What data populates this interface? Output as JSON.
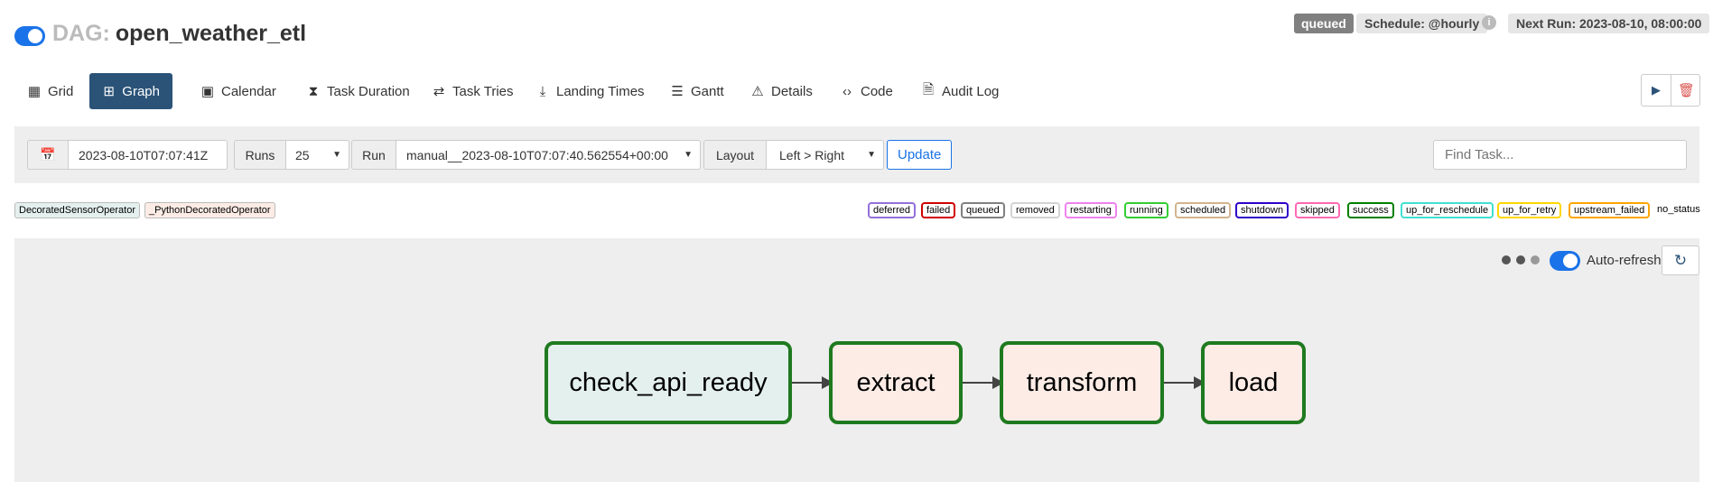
{
  "header": {
    "dag_prefix": "DAG:",
    "dag_id": "open_weather_etl",
    "paused": false,
    "state_badge": "queued",
    "schedule": "Schedule: @hourly",
    "info_icon": "i",
    "next_run": "Next Run: 2023-08-10, 08:00:00"
  },
  "nav": {
    "tabs": [
      {
        "label": "Grid",
        "icon": "grid-icon",
        "glyph": "▦"
      },
      {
        "label": "Graph",
        "icon": "graph-icon",
        "glyph": "⊞",
        "active": true
      },
      {
        "label": "Calendar",
        "icon": "calendar-icon",
        "glyph": "▣"
      },
      {
        "label": "Task Duration",
        "icon": "hourglass-icon",
        "glyph": "⧗"
      },
      {
        "label": "Task Tries",
        "icon": "retry-icon",
        "glyph": "⇄"
      },
      {
        "label": "Landing Times",
        "icon": "plane-landing-icon",
        "glyph": "⤓"
      },
      {
        "label": "Gantt",
        "icon": "gantt-icon",
        "glyph": "☰"
      },
      {
        "label": "Details",
        "icon": "warning-icon",
        "glyph": "⚠"
      },
      {
        "label": "Code",
        "icon": "code-icon",
        "glyph": "‹›"
      },
      {
        "label": "Audit Log",
        "icon": "audit-icon",
        "glyph": "🗎"
      }
    ],
    "actions": {
      "trigger_icon": "play-icon",
      "trigger_glyph": "▶",
      "delete_icon": "trash-icon",
      "delete_glyph": "🗑"
    }
  },
  "toolbar": {
    "calendar_glyph": "📅",
    "base_date": "2023-08-10T07:07:41Z",
    "runs_label": "Runs",
    "runs_value": "25",
    "run_label": "Run",
    "run_value": "manual__2023-08-10T07:07:40.562554+00:00",
    "layout_label": "Layout",
    "layout_value": "Left > Right",
    "update_label": "Update",
    "find_task_placeholder": "Find Task..."
  },
  "legend": {
    "operators": [
      {
        "label": "DecoratedSensorOperator",
        "color": "#e4f0ee"
      },
      {
        "label": "_PythonDecoratedOperator",
        "color": "#fdece6"
      }
    ],
    "statuses": [
      {
        "label": "deferred",
        "color": "#9370db"
      },
      {
        "label": "failed",
        "color": "#d00000"
      },
      {
        "label": "queued",
        "color": "#808080"
      },
      {
        "label": "removed",
        "color": "#d3d3d3"
      },
      {
        "label": "restarting",
        "color": "#ee82ee"
      },
      {
        "label": "running",
        "color": "#32cd32"
      },
      {
        "label": "scheduled",
        "color": "#d2b48c"
      },
      {
        "label": "shutdown",
        "color": "#2e00c8"
      },
      {
        "label": "skipped",
        "color": "#ff69b4"
      },
      {
        "label": "success",
        "color": "#008000"
      },
      {
        "label": "up_for_reschedule",
        "color": "#40e0d0"
      },
      {
        "label": "up_for_retry",
        "color": "#ffd700"
      },
      {
        "label": "upstream_failed",
        "color": "#ffa500"
      }
    ],
    "no_status": "no_status"
  },
  "graph": {
    "auto_refresh_label": "Auto-refresh",
    "auto_refresh_on": true,
    "refresh_glyph": "↻",
    "tasks": [
      {
        "id": "check_api_ready",
        "operator": "DecoratedSensorOperator",
        "state": "success"
      },
      {
        "id": "extract",
        "operator": "_PythonDecoratedOperator",
        "state": "success"
      },
      {
        "id": "transform",
        "operator": "_PythonDecoratedOperator",
        "state": "success"
      },
      {
        "id": "load",
        "operator": "_PythonDecoratedOperator",
        "state": "success"
      }
    ]
  }
}
